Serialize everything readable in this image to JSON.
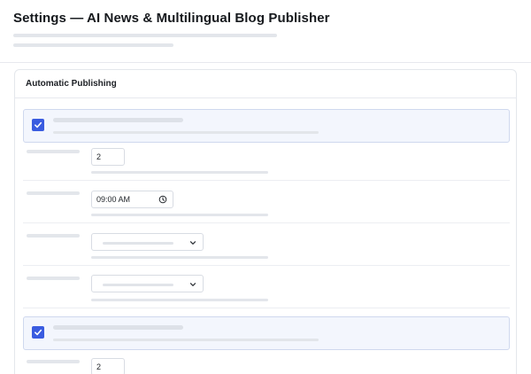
{
  "header": {
    "title": "Settings — AI News & Multilingual Blog Publisher"
  },
  "section": {
    "title": "Automatic Publishing"
  },
  "fields": {
    "count_1": "2",
    "time": "09:00 AM",
    "count_2": "2"
  },
  "icons": {
    "check": "check-icon",
    "clock": "clock-icon",
    "chevron": "chevron-down-icon"
  },
  "colors": {
    "accent": "#3a5ce0",
    "highlight_bg": "#f3f6fd",
    "highlight_border": "#cfd8ee"
  }
}
